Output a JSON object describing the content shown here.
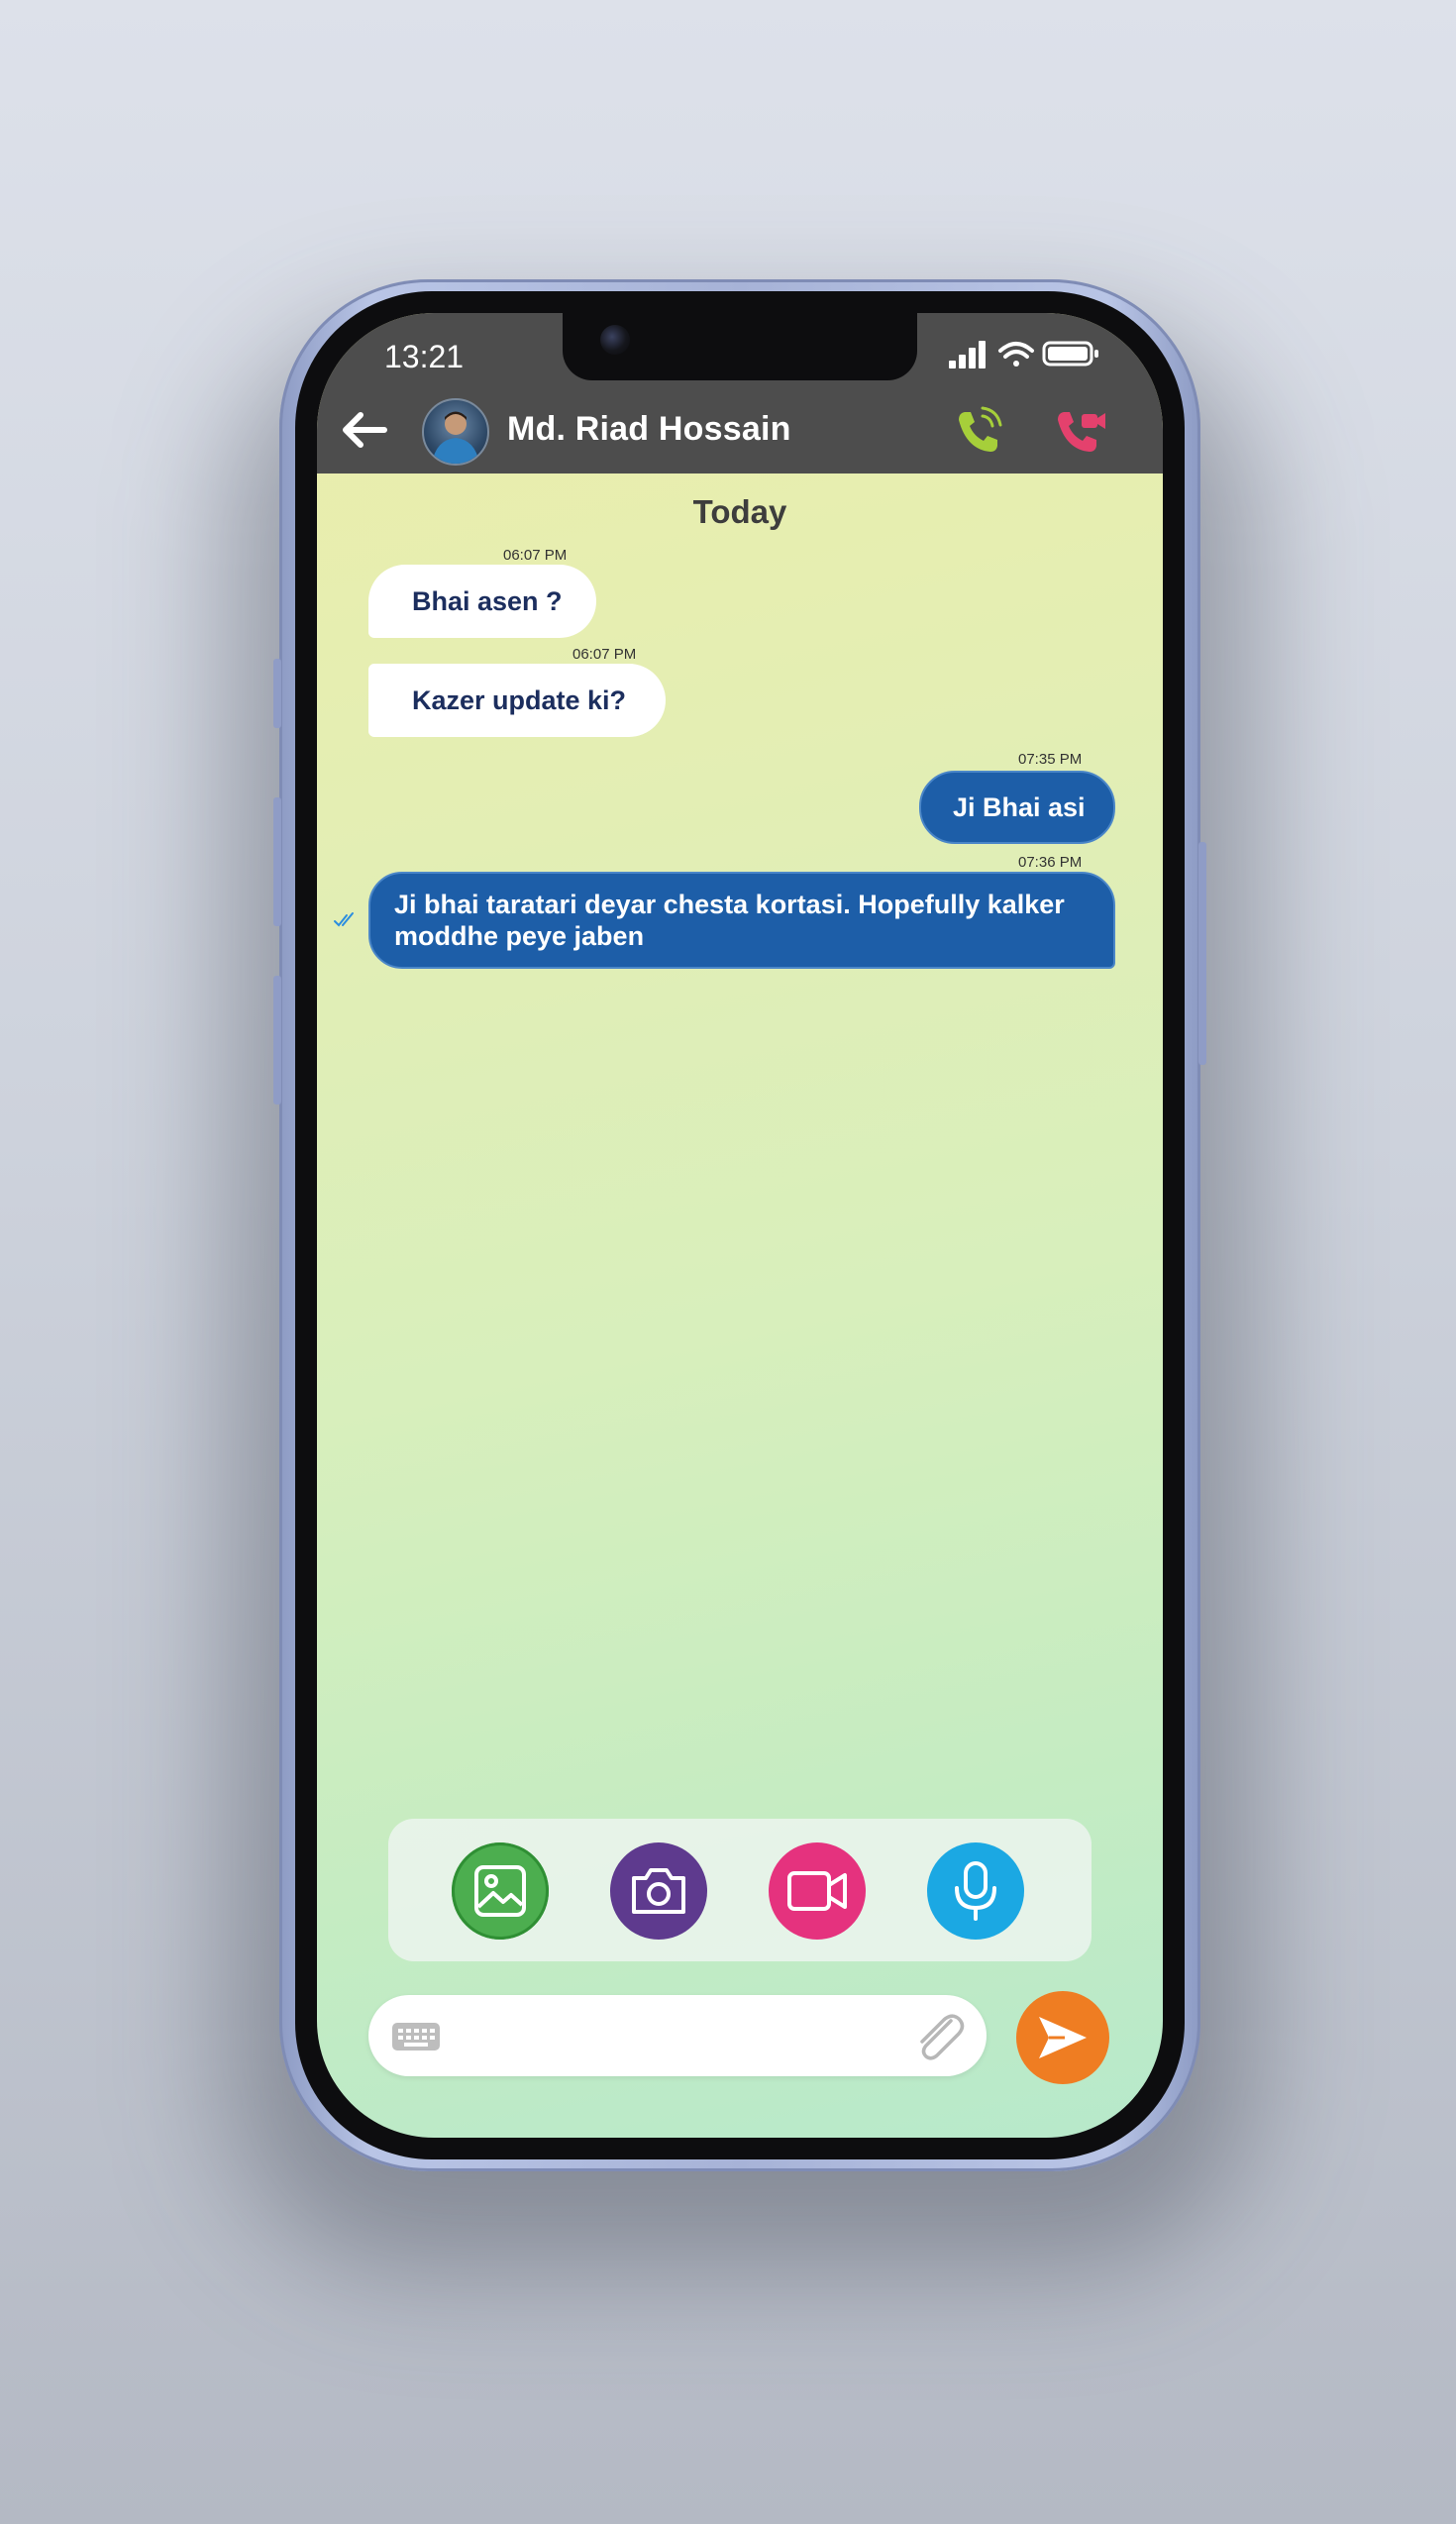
{
  "status_bar": {
    "time": "13:21"
  },
  "header": {
    "contact_name": "Md. Riad Hossain",
    "back_icon": "arrow-left-icon",
    "call_icon": "phone-ringing-icon",
    "video_call_icon": "video-call-icon",
    "colors": {
      "bar": "#4d4d4d",
      "call": "#a6cf3a",
      "video": "#e4416d"
    }
  },
  "chat": {
    "day_label": "Today",
    "messages": [
      {
        "direction": "incoming",
        "time": "06:07 PM",
        "text": "Bhai asen ?"
      },
      {
        "direction": "incoming",
        "time": "06:07 PM",
        "text": "Kazer update ki?"
      },
      {
        "direction": "outgoing",
        "time": "07:35 PM",
        "text": "Ji Bhai asi"
      },
      {
        "direction": "outgoing",
        "time": "07:36 PM",
        "text": "Ji bhai taratari deyar chesta kortasi. Hopefully kalker moddhe peye jaben",
        "status": "read"
      }
    ]
  },
  "actions": [
    {
      "name": "gallery",
      "icon": "image-icon",
      "color": "#4cae4f"
    },
    {
      "name": "camera",
      "icon": "camera-icon",
      "color": "#5e3a8e"
    },
    {
      "name": "video",
      "icon": "video-icon",
      "color": "#e5327e"
    },
    {
      "name": "voice",
      "icon": "microphone-icon",
      "color": "#1ba8e3"
    }
  ],
  "composer": {
    "placeholder": "",
    "keyboard_icon": "keyboard-icon",
    "attach_icon": "paperclip-icon",
    "send_icon": "send-icon",
    "send_color": "#ef7d22"
  }
}
